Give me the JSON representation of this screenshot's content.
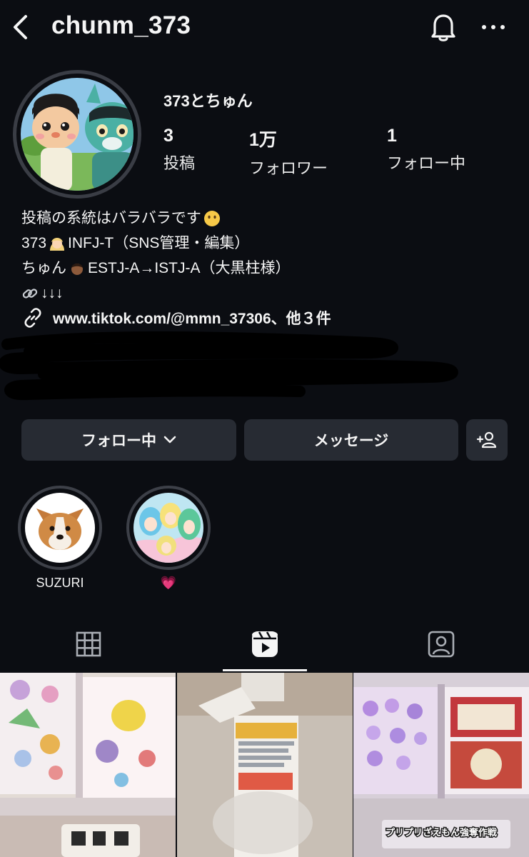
{
  "header": {
    "username": "chunm_373",
    "icons": {
      "back": "chevron-left-icon",
      "notifications": "bell-icon",
      "more": "more-horizontal-icon"
    }
  },
  "profile": {
    "display_name": "373とちゅん",
    "stats": [
      {
        "value": "3",
        "label": "投稿"
      },
      {
        "value": "1万",
        "label": "フォロワー"
      },
      {
        "value": "1",
        "label": "フォロー中"
      }
    ],
    "bio": {
      "line1": {
        "text": "投稿の系統はバラバラです",
        "emoji": "speechless-face-emoji"
      },
      "line2": {
        "prefix": "373",
        "emoji": "blonde-person-emoji",
        "text": "INFJ-T（SNS管理・編集）"
      },
      "line3": {
        "prefix": "ちゅん",
        "emoji": "man-dark-skin-emoji",
        "text": "ESTJ-A→ISTJ-A（大黒柱様）"
      },
      "line4": {
        "emoji": "link-emoji",
        "text": "↓↓↓"
      }
    },
    "link": {
      "text": "www.tiktok.com/@mmn_37306、他３件",
      "icon": "link-icon"
    }
  },
  "actions": {
    "follow_label": "フォロー中",
    "message_label": "メッセージ",
    "add_icon": "add-person-icon"
  },
  "highlights": [
    {
      "label": "SUZURI",
      "image": "corgi-face"
    },
    {
      "label": "💗",
      "image": "anime-girls"
    }
  ],
  "tabs": [
    {
      "icon": "grid-icon",
      "active": false
    },
    {
      "icon": "reels-icon",
      "active": true
    },
    {
      "icon": "tagged-icon",
      "active": false
    }
  ],
  "posts": [
    {
      "image": "sticker-book"
    },
    {
      "image": "gum-box"
    },
    {
      "image": "sticker-book-purple",
      "caption": "プリプリざえもん強奪作戦"
    }
  ],
  "colors": {
    "background": "#0b0d12",
    "button": "#272b33",
    "ring": "#3a3d45",
    "text": "#f5f5f5"
  }
}
